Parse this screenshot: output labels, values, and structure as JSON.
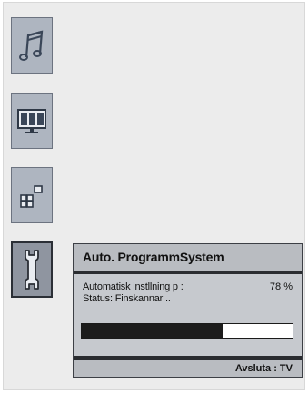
{
  "menu_icons": [
    {
      "name": "music-note-icon",
      "active": false
    },
    {
      "name": "screen-icon",
      "active": false
    },
    {
      "name": "blocks-icon",
      "active": false
    },
    {
      "name": "wrench-icon",
      "active": true
    }
  ],
  "dialog": {
    "title": "Auto. ProgrammSystem",
    "auto_label": "Automatisk instllning p :",
    "percent_text": "78 %",
    "status_text": "Status: Finskannar ..",
    "progress": 0.67,
    "exit_label": "Avsluta : TV"
  },
  "colors": {
    "panel_bg": "#ececec",
    "icon_bg": "#aeb5c0",
    "dialog_bg": "#b9bcc1",
    "bar_fill": "#1c1c1c"
  }
}
